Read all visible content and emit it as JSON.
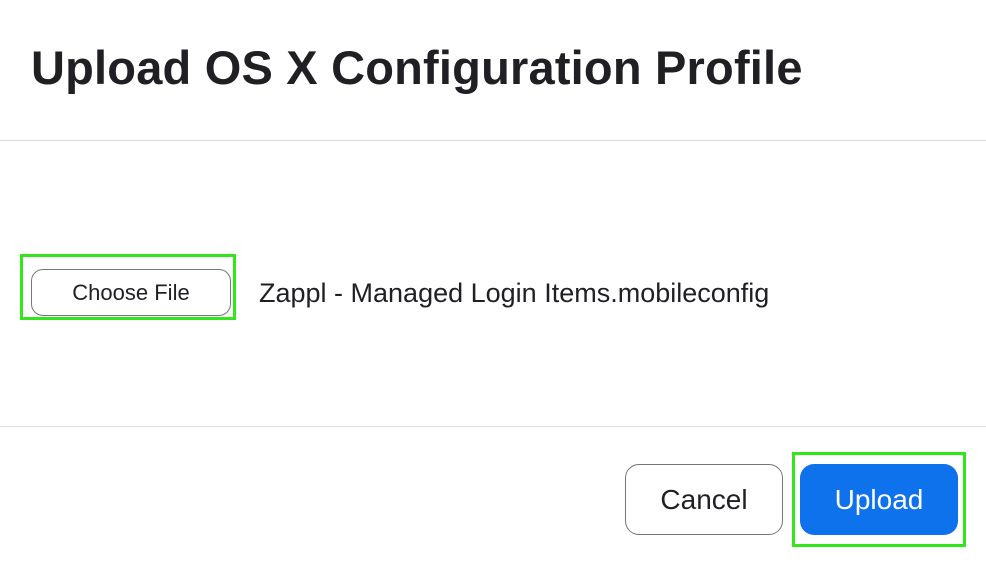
{
  "dialog": {
    "title": "Upload OS X Configuration Profile"
  },
  "file_input": {
    "button_label": "Choose File",
    "file_name": "Zappl - Managed Login Items.mobileconfig"
  },
  "footer": {
    "cancel_label": "Cancel",
    "upload_label": "Upload"
  },
  "colors": {
    "primary": "#0e72ed",
    "highlight": "#33e61a",
    "text": "#1f1f24",
    "divider": "#dcdde3"
  }
}
